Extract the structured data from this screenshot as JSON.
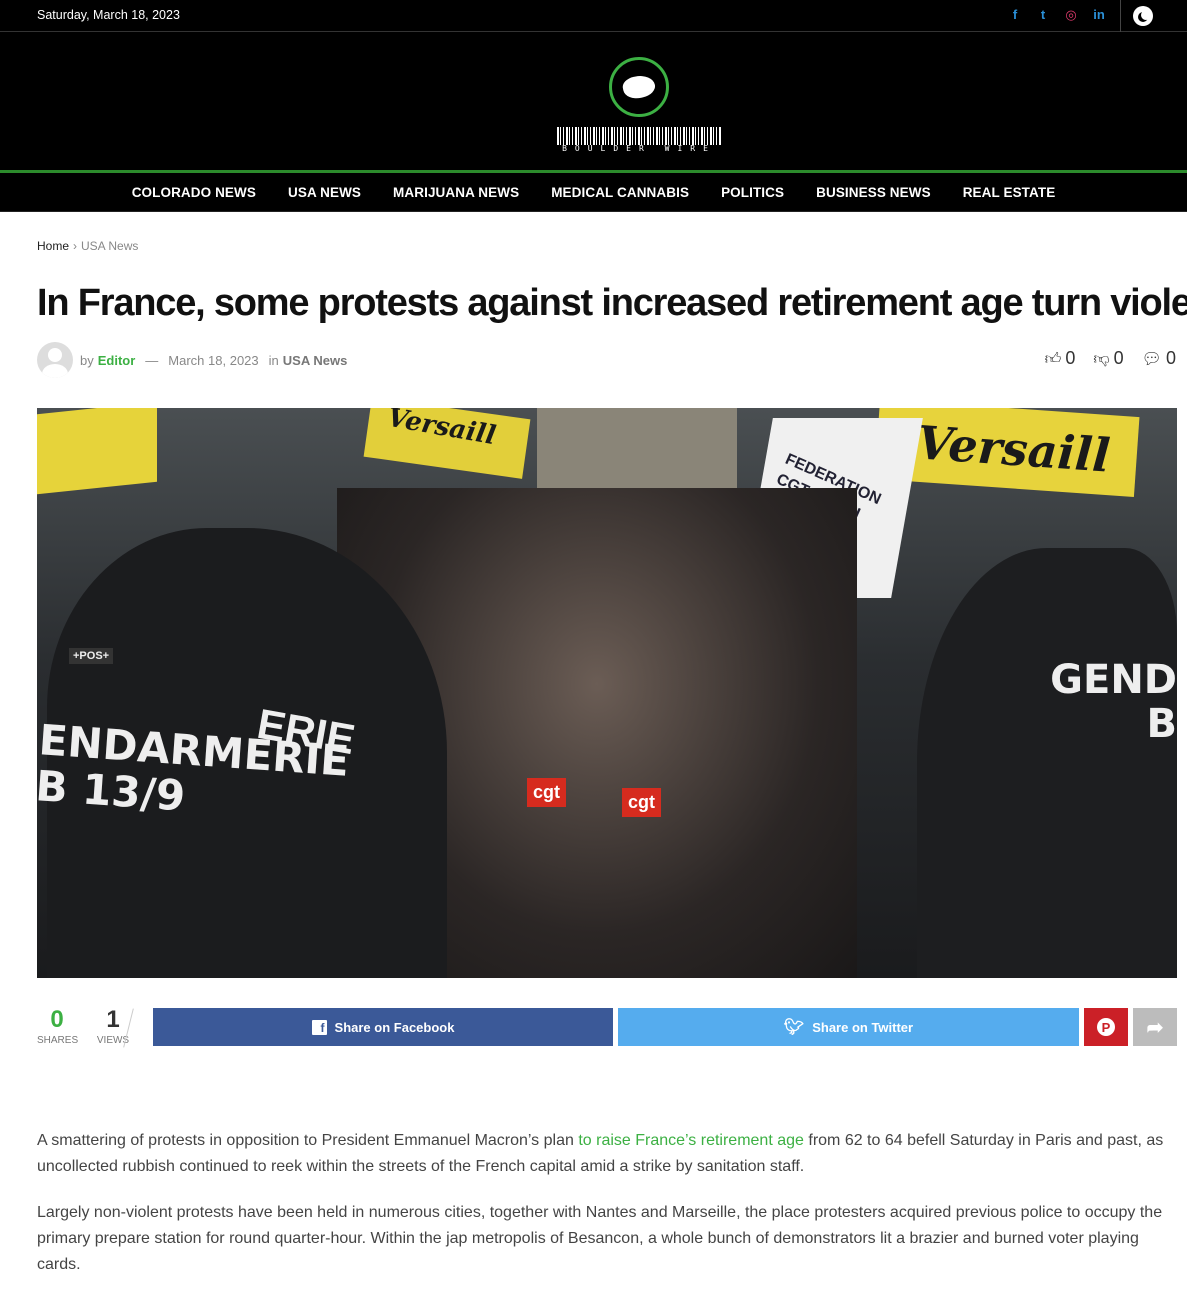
{
  "topbar": {
    "date": "Saturday, March 18, 2023",
    "social": [
      {
        "icon": "facebook-icon",
        "glyph": "f"
      },
      {
        "icon": "twitter-icon",
        "glyph": "t"
      },
      {
        "icon": "instagram-icon",
        "glyph": "◎"
      },
      {
        "icon": "linkedin-icon",
        "glyph": "in"
      }
    ],
    "dark_mode_icon": "moon-icon"
  },
  "logo": {
    "text": "BOULDER WIRE"
  },
  "nav": [
    "COLORADO NEWS",
    "USA NEWS",
    "MARIJUANA NEWS",
    "MEDICAL CANNABIS",
    "POLITICS",
    "BUSINESS NEWS",
    "REAL ESTATE"
  ],
  "breadcrumb": {
    "home": "Home",
    "sep": "›",
    "current": "USA News"
  },
  "article": {
    "title": "In France, some protests against increased retirement age turn violent",
    "by": "by",
    "author": "Editor",
    "dash": "—",
    "date": "March 18, 2023",
    "in": "in",
    "category": "USA News",
    "likes": "0",
    "dislikes": "0",
    "comments": "0",
    "paragraph1_before": "A smattering of protests in opposition to President Emmanuel Macron’s plan ",
    "paragraph1_link": "to raise France’s retirement age",
    "paragraph1_after": " from 62 to 64 befell Saturday in Paris and past, as uncollected rubbish continued to reek within the streets of the French capital amid a strike by sanitation staff.",
    "paragraph2": "Largely non-violent protests have been held in numerous cities, together with Nantes and Marseille, the place protesters acquired previous police to occupy the primary prepare station for round quarter-hour. Within the jap metropolis of Besancon, a whole bunch of demonstrators lit a brazier and burned voter playing cards."
  },
  "hero": {
    "gendarmerie_left": "ENDARMERIE\nB 13/9",
    "erie": "ERIE",
    "gendarmerie_right": "GEND\nB",
    "banner_text": "Versaill",
    "pos_tag": "+POS+",
    "cgt1": "cgt",
    "cgt2": "cgt",
    "flag_text": "FEDERATION\nCGT CHEMI"
  },
  "share": {
    "shares_count": "0",
    "shares_label": "SHARES",
    "views_count": "1",
    "views_label": "VIEWS",
    "facebook_label": "Share on Facebook",
    "twitter_label": "Share on Twitter"
  },
  "colors": {
    "accent": "#3cb043",
    "facebook": "#3b5998",
    "twitter": "#55acee",
    "pinterest": "#cb2027"
  }
}
